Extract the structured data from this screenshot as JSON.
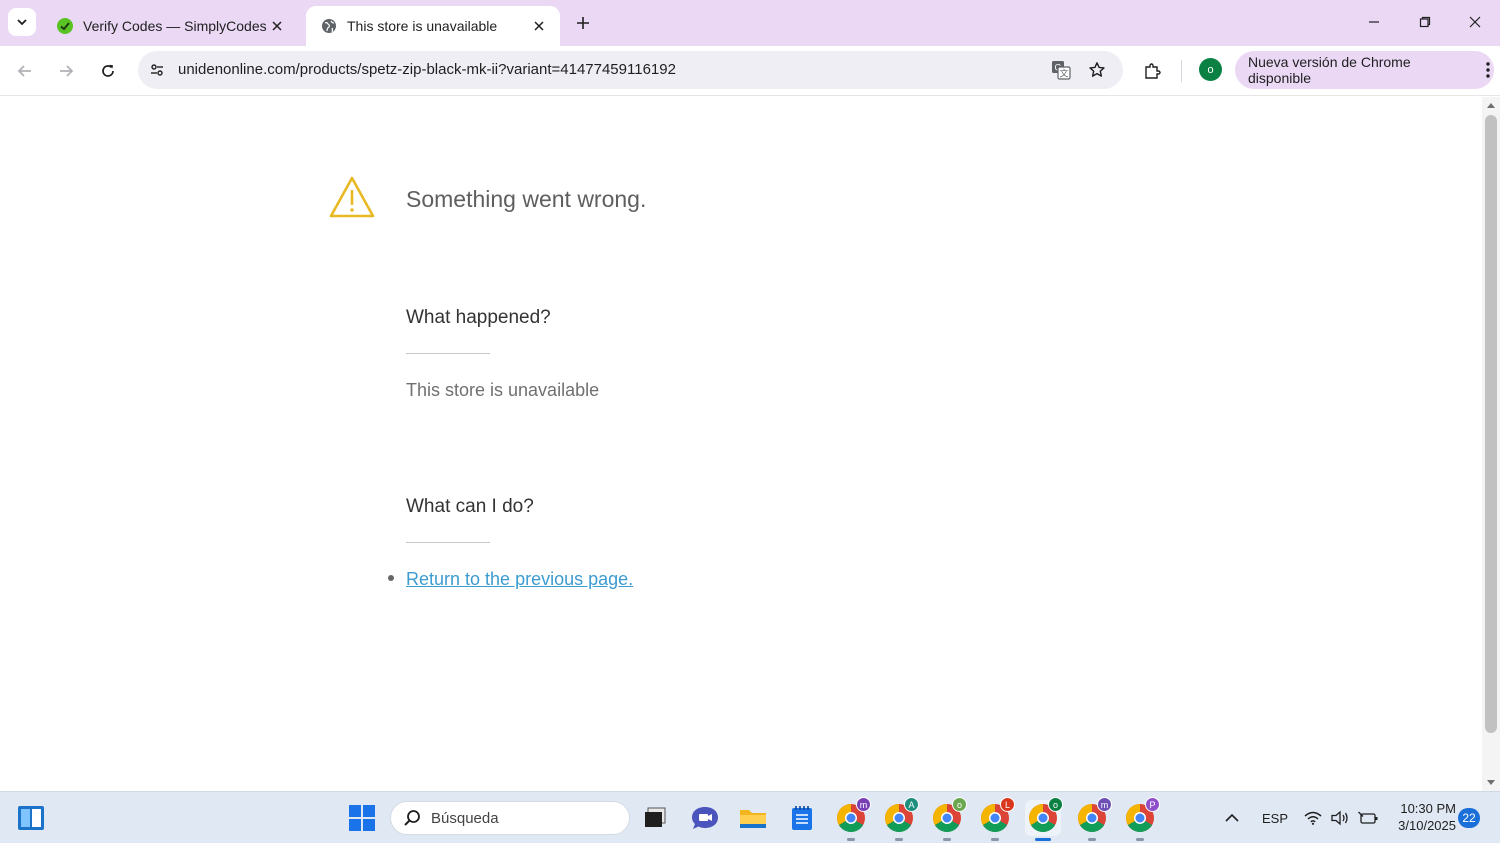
{
  "browser": {
    "tabs": [
      {
        "title": "Verify Codes — SimplyCodes",
        "active": false
      },
      {
        "title": "This store is unavailable",
        "active": true
      }
    ],
    "url": "unidenonline.com/products/spetz-zip-black-mk-ii?variant=41477459116192",
    "profile_initial": "o",
    "update_label": "Nueva versión de Chrome disponible"
  },
  "page": {
    "error_title": "Something went wrong.",
    "section1_heading": "What happened?",
    "section1_text": "This store is unavailable",
    "section2_heading": "What can I do?",
    "link_text": "Return to the previous page."
  },
  "taskbar": {
    "search_placeholder": "Búsqueda",
    "chrome_profiles": [
      {
        "letter": "m",
        "color": "#7b3fb5"
      },
      {
        "letter": "A",
        "color": "#1e8e7e"
      },
      {
        "letter": "o",
        "color": "#6aa84f"
      },
      {
        "letter": "L",
        "color": "#d9381e"
      },
      {
        "letter": "o",
        "color": "#0b8043"
      },
      {
        "letter": "m",
        "color": "#6d4fb5"
      },
      {
        "letter": "P",
        "color": "#8e4fc9"
      }
    ],
    "language": "ESP",
    "time": "10:30 PM",
    "date": "3/10/2025",
    "notifications": "22"
  },
  "colors": {
    "tabstrip": "#ead8f4",
    "link": "#3c9bd0",
    "warning": "#e8b923",
    "taskbar": "#dfe8f3"
  }
}
